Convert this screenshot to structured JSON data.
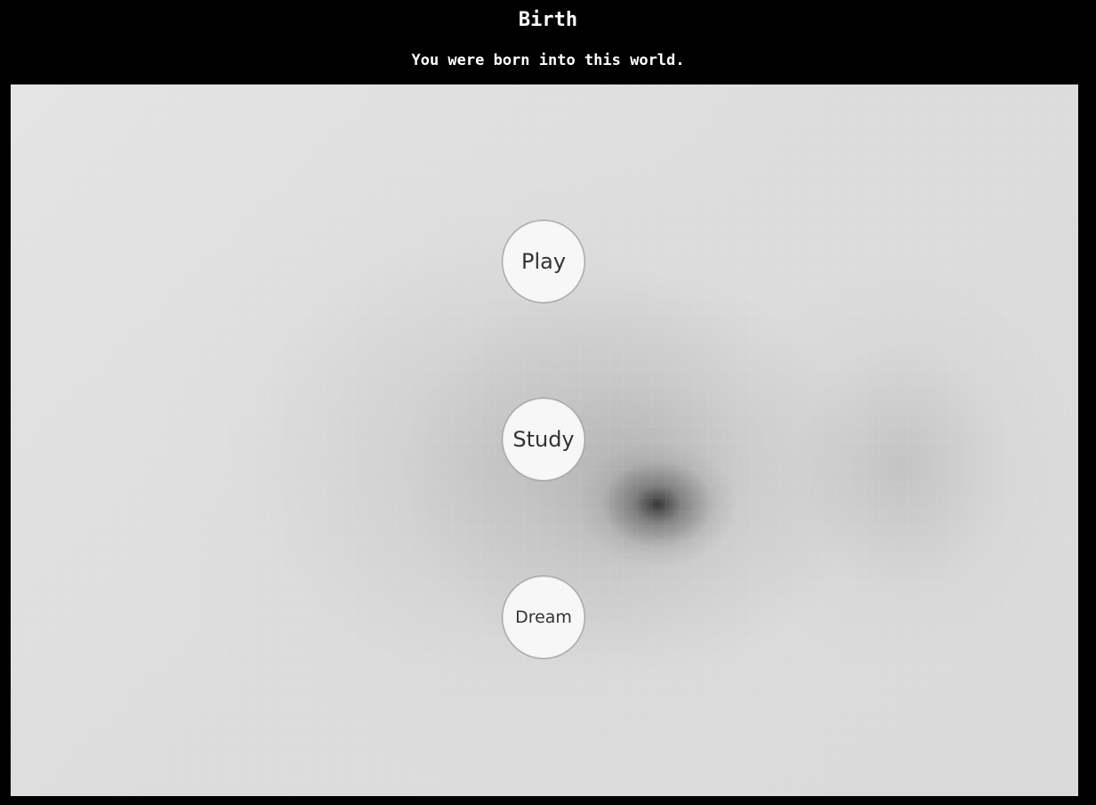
{
  "header": {
    "title": "Birth",
    "subtitle": "You were born into this world."
  },
  "choices": [
    {
      "label": "Play"
    },
    {
      "label": "Study"
    },
    {
      "label": "Dream"
    }
  ],
  "colors": {
    "background": "#000000",
    "header_text": "#ffffff",
    "choice_fill": "#f8f7f7",
    "choice_text": "#333333"
  }
}
